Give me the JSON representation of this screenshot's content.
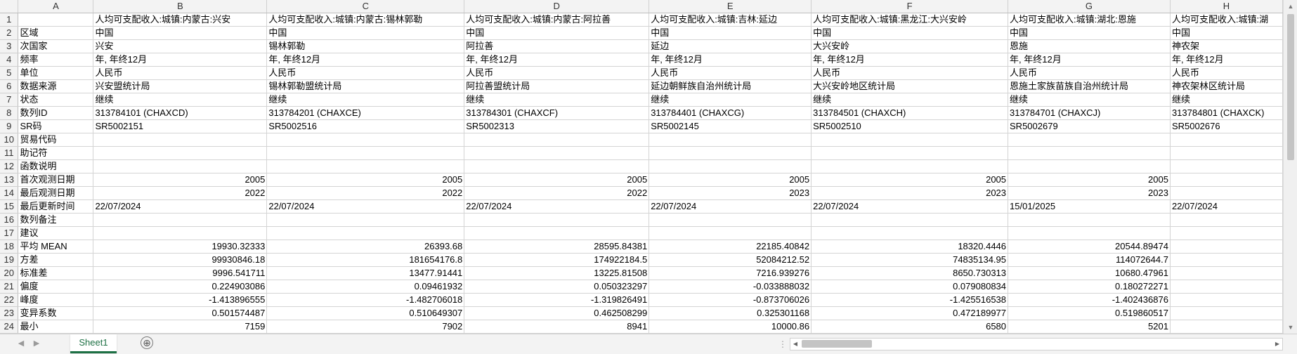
{
  "column_headers": [
    "A",
    "B",
    "C",
    "D",
    "E",
    "F",
    "G",
    "H"
  ],
  "rows": [
    {
      "n": "1",
      "a": "",
      "cells": [
        "人均可支配收入:城镇:内蒙古:兴安",
        "人均可支配收入:城镇:内蒙古:锡林郭勒",
        "人均可支配收入:城镇:内蒙古:阿拉善",
        "人均可支配收入:城镇:吉林:延边",
        "人均可支配收入:城镇:黑龙江:大兴安岭",
        "人均可支配收入:城镇:湖北:恩施",
        "人均可支配收入:城镇:湖"
      ]
    },
    {
      "n": "2",
      "a": "区域",
      "cells": [
        "中国",
        "中国",
        "中国",
        "中国",
        "中国",
        "中国",
        "中国"
      ]
    },
    {
      "n": "3",
      "a": "次国家",
      "cells": [
        "兴安",
        "锡林郭勒",
        "阿拉善",
        "延边",
        "大兴安岭",
        "恩施",
        "神农架"
      ]
    },
    {
      "n": "4",
      "a": "频率",
      "cells": [
        "年, 年终12月",
        "年, 年终12月",
        "年, 年终12月",
        "年, 年终12月",
        "年, 年终12月",
        "年, 年终12月",
        "年, 年终12月"
      ]
    },
    {
      "n": "5",
      "a": "单位",
      "cells": [
        "人民币",
        "人民币",
        "人民币",
        "人民币",
        "人民币",
        "人民币",
        "人民币"
      ]
    },
    {
      "n": "6",
      "a": "数据来源",
      "cells": [
        "兴安盟统计局",
        "锡林郭勒盟统计局",
        "阿拉善盟统计局",
        "延边朝鲜族自治州统计局",
        "大兴安岭地区统计局",
        "恩施土家族苗族自治州统计局",
        "神农架林区统计局"
      ]
    },
    {
      "n": "7",
      "a": "状态",
      "cells": [
        "继续",
        "继续",
        "继续",
        "继续",
        "继续",
        "继续",
        "继续"
      ]
    },
    {
      "n": "8",
      "a": "数列ID",
      "cells": [
        "313784101 (CHAXCD)",
        "313784201 (CHAXCE)",
        "313784301 (CHAXCF)",
        "313784401 (CHAXCG)",
        "313784501 (CHAXCH)",
        "313784701 (CHAXCJ)",
        "313784801 (CHAXCK)"
      ]
    },
    {
      "n": "9",
      "a": "SR码",
      "cells": [
        "SR5002151",
        "SR5002516",
        "SR5002313",
        "SR5002145",
        "SR5002510",
        "SR5002679",
        "SR5002676"
      ]
    },
    {
      "n": "10",
      "a": "贸易代码",
      "cells": [
        "",
        "",
        "",
        "",
        "",
        "",
        ""
      ]
    },
    {
      "n": "11",
      "a": "助记符",
      "cells": [
        "",
        "",
        "",
        "",
        "",
        "",
        ""
      ]
    },
    {
      "n": "12",
      "a": "函数说明",
      "cells": [
        "",
        "",
        "",
        "",
        "",
        "",
        ""
      ]
    },
    {
      "n": "13",
      "a": "首次观测日期",
      "num": true,
      "cells": [
        "2005",
        "2005",
        "2005",
        "2005",
        "2005",
        "2005",
        ""
      ]
    },
    {
      "n": "14",
      "a": "最后观测日期",
      "num": true,
      "cells": [
        "2022",
        "2022",
        "2022",
        "2023",
        "2023",
        "2023",
        ""
      ]
    },
    {
      "n": "15",
      "a": "最后更新时间",
      "cells": [
        "22/07/2024",
        "22/07/2024",
        "22/07/2024",
        "22/07/2024",
        "22/07/2024",
        "15/01/2025",
        "22/07/2024"
      ]
    },
    {
      "n": "16",
      "a": "数列备注",
      "cells": [
        "",
        "",
        "",
        "",
        "",
        "",
        ""
      ]
    },
    {
      "n": "17",
      "a": "建议",
      "cells": [
        "",
        "",
        "",
        "",
        "",
        "",
        ""
      ]
    },
    {
      "n": "18",
      "a": "平均 MEAN",
      "num": true,
      "cells": [
        "19930.32333",
        "26393.68",
        "28595.84381",
        "22185.40842",
        "18320.4446",
        "20544.89474",
        ""
      ]
    },
    {
      "n": "19",
      "a": "方差",
      "num": true,
      "cells": [
        "99930846.18",
        "181654176.8",
        "174922184.5",
        "52084212.52",
        "74835134.95",
        "114072644.7",
        ""
      ]
    },
    {
      "n": "20",
      "a": "标准差",
      "num": true,
      "cells": [
        "9996.541711",
        "13477.91441",
        "13225.81508",
        "7216.939276",
        "8650.730313",
        "10680.47961",
        ""
      ]
    },
    {
      "n": "21",
      "a": "偏度",
      "num": true,
      "cells": [
        "0.224903086",
        "0.09461932",
        "0.050323297",
        "-0.033888032",
        "0.079080834",
        "0.180272271",
        ""
      ]
    },
    {
      "n": "22",
      "a": "峰度",
      "num": true,
      "cells": [
        "-1.413896555",
        "-1.482706018",
        "-1.319826491",
        "-0.873706026",
        "-1.425516538",
        "-1.402436876",
        ""
      ]
    },
    {
      "n": "23",
      "a": "变异系数",
      "num": true,
      "cells": [
        "0.501574487",
        "0.510649307",
        "0.462508299",
        "0.325301168",
        "0.472189977",
        "0.519860517",
        ""
      ]
    },
    {
      "n": "24",
      "a": "最小",
      "num": true,
      "cells": [
        "7159",
        "7902",
        "8941",
        "10000.86",
        "6580",
        "5201",
        ""
      ]
    }
  ],
  "sheet_tab": "Sheet1",
  "add_sheet_glyph": "⊕"
}
